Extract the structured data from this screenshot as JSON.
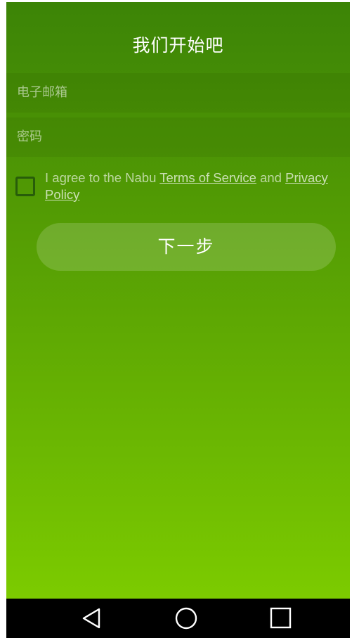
{
  "header": {
    "title": "我们开始吧"
  },
  "form": {
    "email_placeholder": "电子邮箱",
    "password_placeholder": "密码",
    "terms": {
      "checked": false,
      "prefix": "I agree to the Nabu ",
      "terms_link": "Terms of Service",
      "middle": " and ",
      "privacy_link": "Privacy Policy"
    },
    "next_label": "下一步"
  },
  "navbar": {
    "icons": [
      "back-icon",
      "home-icon",
      "recents-icon"
    ]
  },
  "colors": {
    "gradient_top": "#3c8406",
    "gradient_bottom": "#7ccb00",
    "checkbox_border": "#285d0a",
    "navbar": "#000000"
  }
}
